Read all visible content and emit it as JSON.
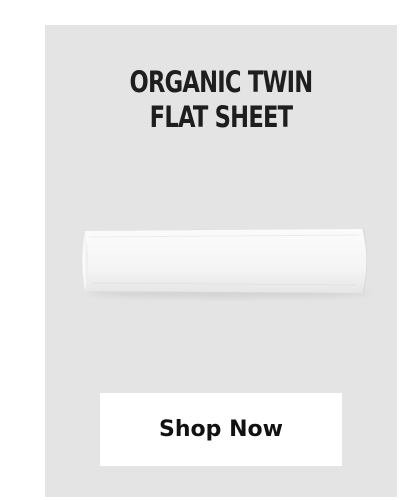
{
  "product": {
    "title_line_1": "ORGANIC TWIN",
    "title_line_2": "FLAT SHEET",
    "image_icon": "folded-white-sheet"
  },
  "cta": {
    "label": "Shop Now"
  },
  "colors": {
    "card_background": "#e4e4e4",
    "page_background": "#ffffff",
    "button_background": "#ffffff",
    "title_text": "#1e1e1e",
    "button_text": "#111111"
  }
}
